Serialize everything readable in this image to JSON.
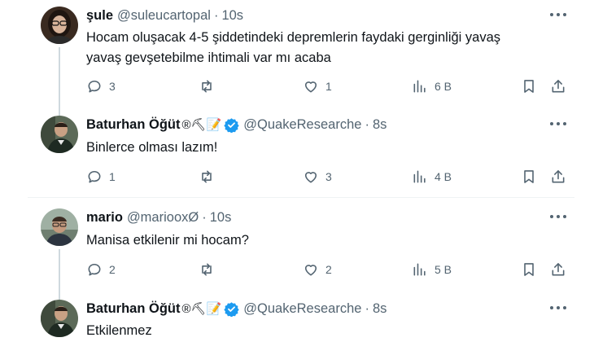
{
  "tweets": [
    {
      "name": "şule",
      "handle": "@suleucartopal",
      "time": "10s",
      "text_lines": [
        "Hocam oluşacak 4-5 şiddetindeki depremlerin faydaki gerginliği yavaş",
        "yavaş gevşetebilme ihtimali var mı acaba"
      ],
      "replies": "3",
      "reposts": "",
      "likes": "1",
      "views": "6 B"
    },
    {
      "name": "Baturhan Öğüt",
      "emojis": "®⛏📝",
      "verified": true,
      "handle": "@QuakeResearche",
      "time": "8s",
      "text_lines": [
        "Binlerce olması lazım!"
      ],
      "replies": "1",
      "reposts": "",
      "likes": "3",
      "views": "4 B"
    },
    {
      "name": "mario",
      "handle": "@mariooxØ",
      "time": "10s",
      "text_lines": [
        "Manisa etkilenir mi hocam?"
      ],
      "replies": "2",
      "reposts": "",
      "likes": "2",
      "views": "5 B"
    },
    {
      "name": "Baturhan Öğüt",
      "emojis": "®⛏📝",
      "verified": true,
      "handle": "@QuakeResearche",
      "time": "8s",
      "text_lines": [
        "Etkilenmez"
      ]
    }
  ],
  "separator": "·",
  "icons": {
    "reply": "reply-icon",
    "repost": "repost-icon",
    "like": "heart-icon",
    "views": "views-bar-chart-icon",
    "bookmark": "bookmark-icon",
    "share": "share-icon",
    "more": "more-dots-icon",
    "verified": "verified-badge-icon"
  },
  "colors": {
    "text": "#0f1419",
    "secondary": "#536471",
    "verified": "#1d9bf0",
    "thread_line": "#cfd9de",
    "divider": "#eff3f4"
  }
}
